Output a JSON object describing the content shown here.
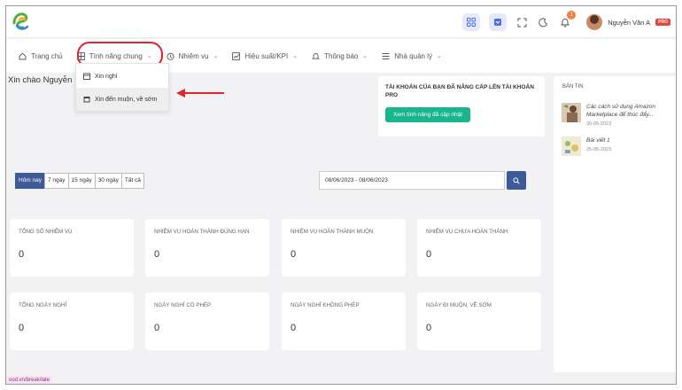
{
  "header": {
    "user_name": "Nguyễn Văn A",
    "user_badge": "PRO",
    "notification_count": "1",
    "accent_color": "#4e6ee8"
  },
  "nav": {
    "items": [
      {
        "label": "Trang chủ",
        "icon": "home-icon"
      },
      {
        "label": "Tính năng chung",
        "icon": "grid-icon"
      },
      {
        "label": "Nhiệm vụ",
        "icon": "clock-icon"
      },
      {
        "label": "Hiệu suất/KPI",
        "icon": "chart-icon"
      },
      {
        "label": "Thông báo",
        "icon": "bell-icon"
      },
      {
        "label": "Nhà quản lý",
        "icon": "list-icon"
      }
    ],
    "chevron": "⌄"
  },
  "dropdown": {
    "items": [
      {
        "label": "Xin nghỉ",
        "icon": "calendar-icon"
      },
      {
        "label": "Xin đến muộn, về sớm",
        "icon": "calendar-icon"
      }
    ]
  },
  "greeting": "Xin chào Nguyễn",
  "upgrade": {
    "text": "TÀI KHOẢN CỦA BẠN ĐÃ NÂNG CẤP LÊN TÀI KHOẢN PRO",
    "button": "Xem tính năng đã cập nhật"
  },
  "news": {
    "heading": "BẢN TIN",
    "items": [
      {
        "title": "Các cách sử dụng Amazon Marketplace để thúc đẩy...",
        "date": "30-05-2023"
      },
      {
        "title": "Bài viết 1",
        "date": "25-05-2023"
      }
    ]
  },
  "filter": {
    "buttons": [
      "Hôm nay",
      "7 ngày",
      "15 ngày",
      "30 ngày",
      "Tất cả"
    ],
    "active": "Hôm nay",
    "date_range": "08/06/2023 - 08/06/2023"
  },
  "stats": [
    {
      "label": "TỔNG SỐ NHIỆM VỤ",
      "value": "0"
    },
    {
      "label": "NHIỆM VỤ HOÀN THÀNH ĐÚNG HẠN",
      "value": "0"
    },
    {
      "label": "NHIỆM VỤ HOÀN THÀNH MUỘN",
      "value": "0"
    },
    {
      "label": "NHIỆM VỤ CHƯA HOÀN THÀNH",
      "value": "0"
    },
    {
      "label": "TỔNG NGÀY NGHỈ",
      "value": "0"
    },
    {
      "label": "NGÀY NGHỈ CÓ PHÉP",
      "value": "0"
    },
    {
      "label": "NGÀY NGHỈ KHÔNG PHÉP",
      "value": "0"
    },
    {
      "label": "NGÀY ĐI MUỘN, VỀ SỚM",
      "value": "0"
    }
  ],
  "status_url": "ood.vn/break/late"
}
